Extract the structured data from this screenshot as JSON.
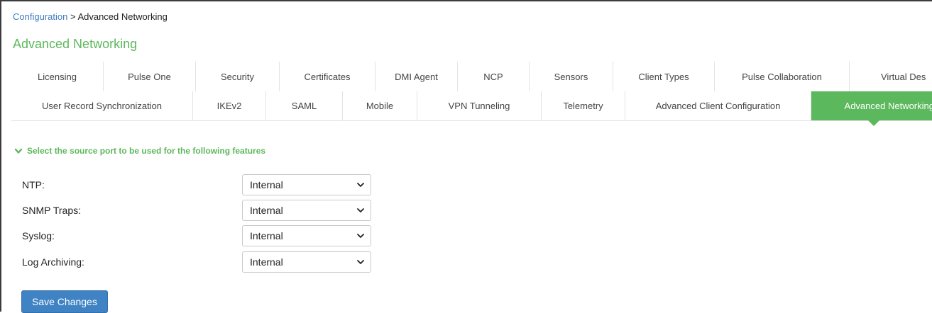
{
  "breadcrumb": {
    "link": "Configuration",
    "separator": " > ",
    "current": "Advanced Networking"
  },
  "page_title": "Advanced Networking",
  "tabs_row1": [
    {
      "label": "Licensing"
    },
    {
      "label": "Pulse One"
    },
    {
      "label": "Security"
    },
    {
      "label": "Certificates"
    },
    {
      "label": "DMI Agent"
    },
    {
      "label": "NCP"
    },
    {
      "label": "Sensors"
    },
    {
      "label": "Client Types"
    },
    {
      "label": "Pulse Collaboration"
    },
    {
      "label": "Virtual Des"
    }
  ],
  "tabs_row2": [
    {
      "label": "User Record Synchronization"
    },
    {
      "label": "IKEv2"
    },
    {
      "label": "SAML"
    },
    {
      "label": "Mobile"
    },
    {
      "label": "VPN Tunneling"
    },
    {
      "label": "Telemetry"
    },
    {
      "label": "Advanced Client Configuration"
    },
    {
      "label": "Advanced Networking",
      "active": true
    }
  ],
  "section": {
    "heading": "Select the source port to be used for the following features"
  },
  "fields": [
    {
      "label": "NTP:",
      "value": "Internal"
    },
    {
      "label": "SNMP Traps:",
      "value": "Internal"
    },
    {
      "label": "Syslog:",
      "value": "Internal"
    },
    {
      "label": "Log Archiving:",
      "value": "Internal"
    }
  ],
  "actions": {
    "save_label": "Save Changes"
  },
  "colors": {
    "accent_green": "#5cb85c",
    "link_blue": "#3f7cbf",
    "button_blue": "#3f83c4"
  }
}
